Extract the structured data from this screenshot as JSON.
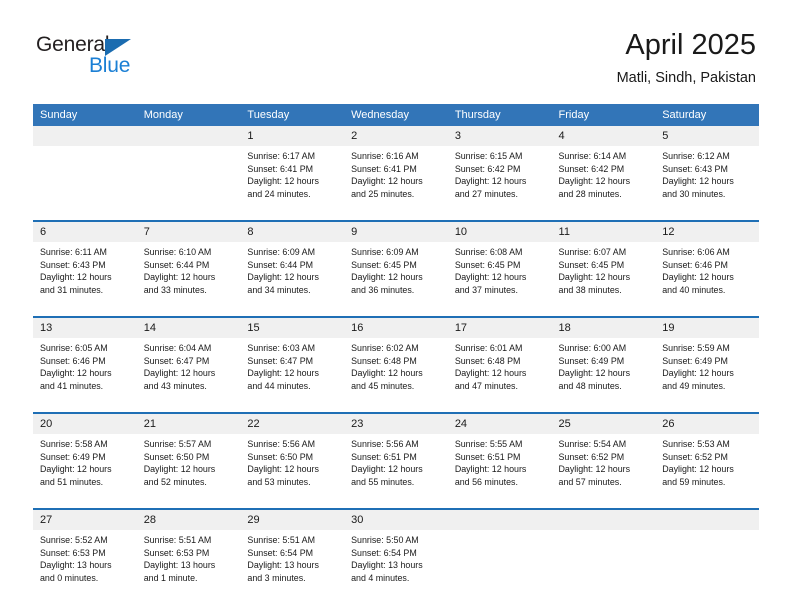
{
  "logo": {
    "word_one": "General",
    "word_two": "Blue",
    "triangle_icon": "triangle-icon",
    "color_dark": "#231f20",
    "color_blue": "#1b7fd4"
  },
  "header": {
    "title": "April 2025",
    "subtitle": "Matli, Sindh, Pakistan"
  },
  "colors": {
    "header_blue": "#3275b8",
    "week_separator_blue": "#1f6fb5",
    "date_band_gray": "#f0f0f0",
    "text": "#1a1a1a"
  },
  "weekday_headers": [
    "Sunday",
    "Monday",
    "Tuesday",
    "Wednesday",
    "Thursday",
    "Friday",
    "Saturday"
  ],
  "weeks": [
    {
      "days": [
        {
          "date": "",
          "sunrise": "",
          "sunset": "",
          "daylight_line1": "",
          "daylight_line2": "",
          "empty": true
        },
        {
          "date": "",
          "sunrise": "",
          "sunset": "",
          "daylight_line1": "",
          "daylight_line2": "",
          "empty": true
        },
        {
          "date": "1",
          "sunrise": "Sunrise: 6:17 AM",
          "sunset": "Sunset: 6:41 PM",
          "daylight_line1": "Daylight: 12 hours",
          "daylight_line2": "and 24 minutes.",
          "empty": false
        },
        {
          "date": "2",
          "sunrise": "Sunrise: 6:16 AM",
          "sunset": "Sunset: 6:41 PM",
          "daylight_line1": "Daylight: 12 hours",
          "daylight_line2": "and 25 minutes.",
          "empty": false
        },
        {
          "date": "3",
          "sunrise": "Sunrise: 6:15 AM",
          "sunset": "Sunset: 6:42 PM",
          "daylight_line1": "Daylight: 12 hours",
          "daylight_line2": "and 27 minutes.",
          "empty": false
        },
        {
          "date": "4",
          "sunrise": "Sunrise: 6:14 AM",
          "sunset": "Sunset: 6:42 PM",
          "daylight_line1": "Daylight: 12 hours",
          "daylight_line2": "and 28 minutes.",
          "empty": false
        },
        {
          "date": "5",
          "sunrise": "Sunrise: 6:12 AM",
          "sunset": "Sunset: 6:43 PM",
          "daylight_line1": "Daylight: 12 hours",
          "daylight_line2": "and 30 minutes.",
          "empty": false
        }
      ]
    },
    {
      "days": [
        {
          "date": "6",
          "sunrise": "Sunrise: 6:11 AM",
          "sunset": "Sunset: 6:43 PM",
          "daylight_line1": "Daylight: 12 hours",
          "daylight_line2": "and 31 minutes.",
          "empty": false
        },
        {
          "date": "7",
          "sunrise": "Sunrise: 6:10 AM",
          "sunset": "Sunset: 6:44 PM",
          "daylight_line1": "Daylight: 12 hours",
          "daylight_line2": "and 33 minutes.",
          "empty": false
        },
        {
          "date": "8",
          "sunrise": "Sunrise: 6:09 AM",
          "sunset": "Sunset: 6:44 PM",
          "daylight_line1": "Daylight: 12 hours",
          "daylight_line2": "and 34 minutes.",
          "empty": false
        },
        {
          "date": "9",
          "sunrise": "Sunrise: 6:09 AM",
          "sunset": "Sunset: 6:45 PM",
          "daylight_line1": "Daylight: 12 hours",
          "daylight_line2": "and 36 minutes.",
          "empty": false
        },
        {
          "date": "10",
          "sunrise": "Sunrise: 6:08 AM",
          "sunset": "Sunset: 6:45 PM",
          "daylight_line1": "Daylight: 12 hours",
          "daylight_line2": "and 37 minutes.",
          "empty": false
        },
        {
          "date": "11",
          "sunrise": "Sunrise: 6:07 AM",
          "sunset": "Sunset: 6:45 PM",
          "daylight_line1": "Daylight: 12 hours",
          "daylight_line2": "and 38 minutes.",
          "empty": false
        },
        {
          "date": "12",
          "sunrise": "Sunrise: 6:06 AM",
          "sunset": "Sunset: 6:46 PM",
          "daylight_line1": "Daylight: 12 hours",
          "daylight_line2": "and 40 minutes.",
          "empty": false
        }
      ]
    },
    {
      "days": [
        {
          "date": "13",
          "sunrise": "Sunrise: 6:05 AM",
          "sunset": "Sunset: 6:46 PM",
          "daylight_line1": "Daylight: 12 hours",
          "daylight_line2": "and 41 minutes.",
          "empty": false
        },
        {
          "date": "14",
          "sunrise": "Sunrise: 6:04 AM",
          "sunset": "Sunset: 6:47 PM",
          "daylight_line1": "Daylight: 12 hours",
          "daylight_line2": "and 43 minutes.",
          "empty": false
        },
        {
          "date": "15",
          "sunrise": "Sunrise: 6:03 AM",
          "sunset": "Sunset: 6:47 PM",
          "daylight_line1": "Daylight: 12 hours",
          "daylight_line2": "and 44 minutes.",
          "empty": false
        },
        {
          "date": "16",
          "sunrise": "Sunrise: 6:02 AM",
          "sunset": "Sunset: 6:48 PM",
          "daylight_line1": "Daylight: 12 hours",
          "daylight_line2": "and 45 minutes.",
          "empty": false
        },
        {
          "date": "17",
          "sunrise": "Sunrise: 6:01 AM",
          "sunset": "Sunset: 6:48 PM",
          "daylight_line1": "Daylight: 12 hours",
          "daylight_line2": "and 47 minutes.",
          "empty": false
        },
        {
          "date": "18",
          "sunrise": "Sunrise: 6:00 AM",
          "sunset": "Sunset: 6:49 PM",
          "daylight_line1": "Daylight: 12 hours",
          "daylight_line2": "and 48 minutes.",
          "empty": false
        },
        {
          "date": "19",
          "sunrise": "Sunrise: 5:59 AM",
          "sunset": "Sunset: 6:49 PM",
          "daylight_line1": "Daylight: 12 hours",
          "daylight_line2": "and 49 minutes.",
          "empty": false
        }
      ]
    },
    {
      "days": [
        {
          "date": "20",
          "sunrise": "Sunrise: 5:58 AM",
          "sunset": "Sunset: 6:49 PM",
          "daylight_line1": "Daylight: 12 hours",
          "daylight_line2": "and 51 minutes.",
          "empty": false
        },
        {
          "date": "21",
          "sunrise": "Sunrise: 5:57 AM",
          "sunset": "Sunset: 6:50 PM",
          "daylight_line1": "Daylight: 12 hours",
          "daylight_line2": "and 52 minutes.",
          "empty": false
        },
        {
          "date": "22",
          "sunrise": "Sunrise: 5:56 AM",
          "sunset": "Sunset: 6:50 PM",
          "daylight_line1": "Daylight: 12 hours",
          "daylight_line2": "and 53 minutes.",
          "empty": false
        },
        {
          "date": "23",
          "sunrise": "Sunrise: 5:56 AM",
          "sunset": "Sunset: 6:51 PM",
          "daylight_line1": "Daylight: 12 hours",
          "daylight_line2": "and 55 minutes.",
          "empty": false
        },
        {
          "date": "24",
          "sunrise": "Sunrise: 5:55 AM",
          "sunset": "Sunset: 6:51 PM",
          "daylight_line1": "Daylight: 12 hours",
          "daylight_line2": "and 56 minutes.",
          "empty": false
        },
        {
          "date": "25",
          "sunrise": "Sunrise: 5:54 AM",
          "sunset": "Sunset: 6:52 PM",
          "daylight_line1": "Daylight: 12 hours",
          "daylight_line2": "and 57 minutes.",
          "empty": false
        },
        {
          "date": "26",
          "sunrise": "Sunrise: 5:53 AM",
          "sunset": "Sunset: 6:52 PM",
          "daylight_line1": "Daylight: 12 hours",
          "daylight_line2": "and 59 minutes.",
          "empty": false
        }
      ]
    },
    {
      "days": [
        {
          "date": "27",
          "sunrise": "Sunrise: 5:52 AM",
          "sunset": "Sunset: 6:53 PM",
          "daylight_line1": "Daylight: 13 hours",
          "daylight_line2": "and 0 minutes.",
          "empty": false
        },
        {
          "date": "28",
          "sunrise": "Sunrise: 5:51 AM",
          "sunset": "Sunset: 6:53 PM",
          "daylight_line1": "Daylight: 13 hours",
          "daylight_line2": "and 1 minute.",
          "empty": false
        },
        {
          "date": "29",
          "sunrise": "Sunrise: 5:51 AM",
          "sunset": "Sunset: 6:54 PM",
          "daylight_line1": "Daylight: 13 hours",
          "daylight_line2": "and 3 minutes.",
          "empty": false
        },
        {
          "date": "30",
          "sunrise": "Sunrise: 5:50 AM",
          "sunset": "Sunset: 6:54 PM",
          "daylight_line1": "Daylight: 13 hours",
          "daylight_line2": "and 4 minutes.",
          "empty": false
        },
        {
          "date": "",
          "sunrise": "",
          "sunset": "",
          "daylight_line1": "",
          "daylight_line2": "",
          "empty": true
        },
        {
          "date": "",
          "sunrise": "",
          "sunset": "",
          "daylight_line1": "",
          "daylight_line2": "",
          "empty": true
        },
        {
          "date": "",
          "sunrise": "",
          "sunset": "",
          "daylight_line1": "",
          "daylight_line2": "",
          "empty": true
        }
      ]
    }
  ]
}
